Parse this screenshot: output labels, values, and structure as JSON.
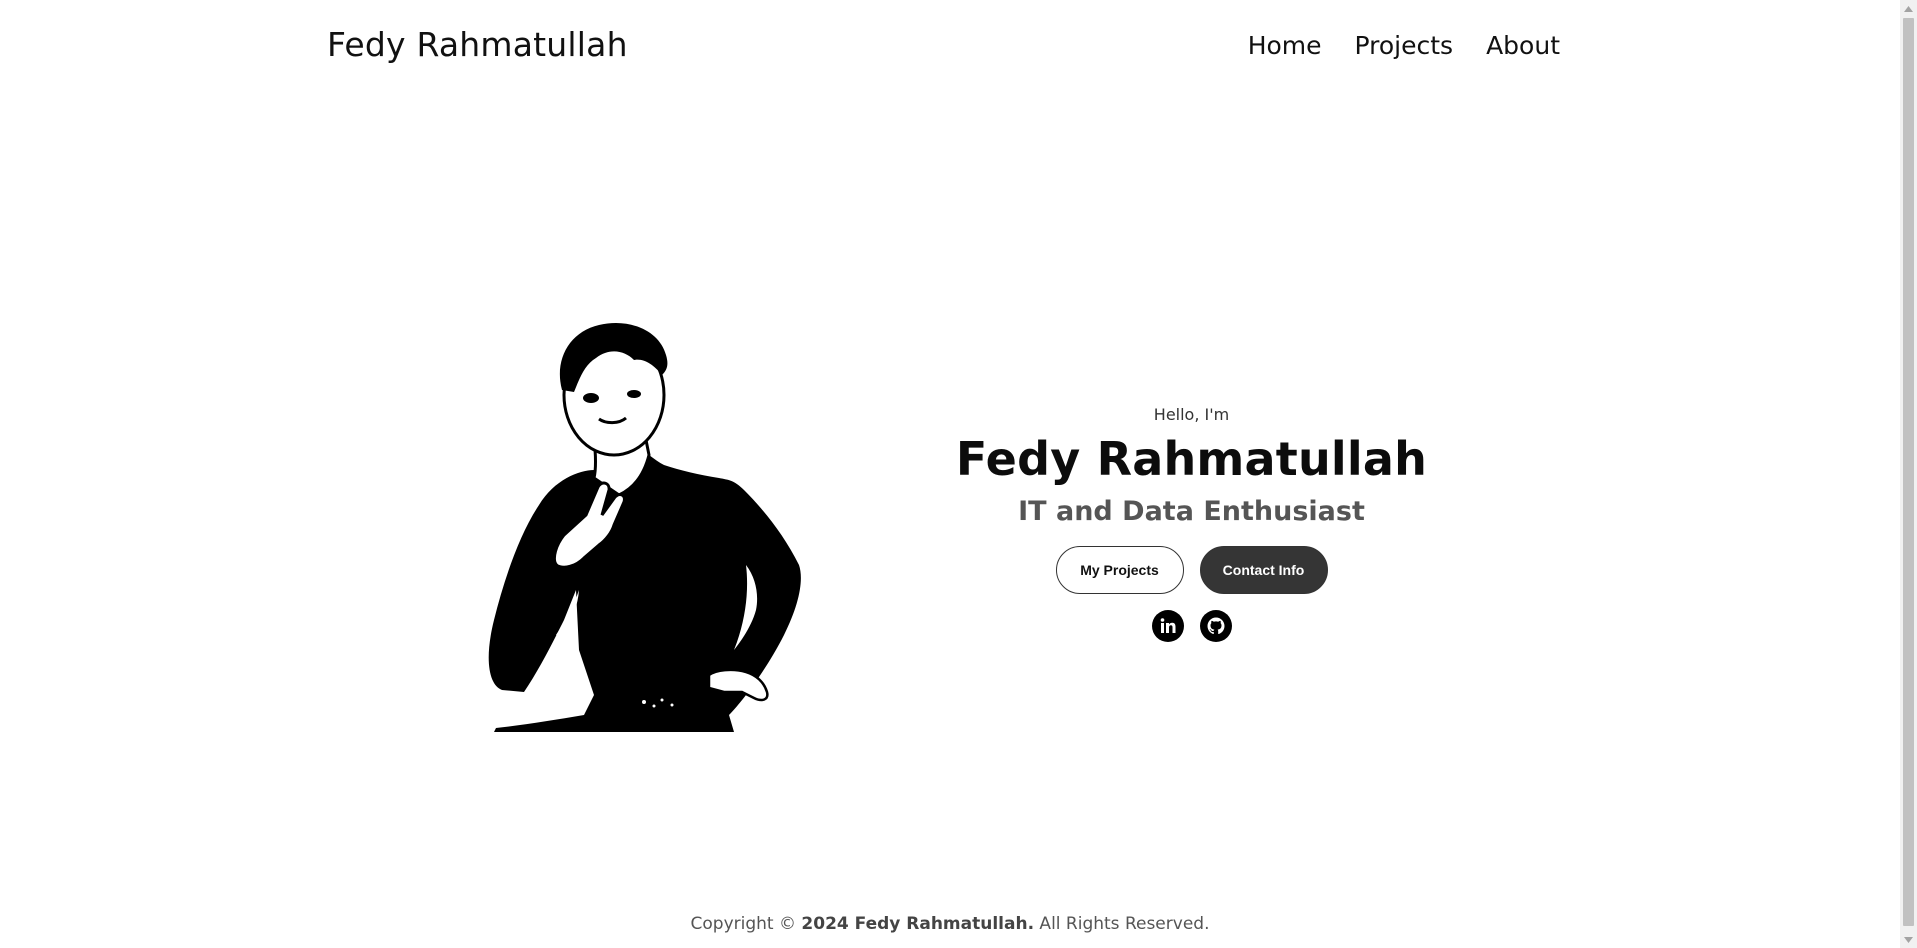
{
  "nav": {
    "logo": "Fedy Rahmatullah",
    "links": [
      {
        "label": "Home"
      },
      {
        "label": "Projects"
      },
      {
        "label": "About"
      }
    ]
  },
  "hero": {
    "greeting": "Hello, I'm",
    "name": "Fedy Rahmatullah",
    "tagline": "IT and Data Enthusiast",
    "buttons": {
      "projects_label": "My Projects",
      "contact_label": "Contact Info"
    },
    "socials": [
      {
        "icon": "linkedin-icon"
      },
      {
        "icon": "github-icon"
      }
    ]
  },
  "footer": {
    "prefix": "Copyright © ",
    "strong": "2024 Fedy Rahmatullah.",
    "suffix": " All Rights Reserved."
  },
  "colors": {
    "text": "#111111",
    "button_dark": "#353535",
    "tagline": "#555555",
    "background": "#ffffff"
  }
}
